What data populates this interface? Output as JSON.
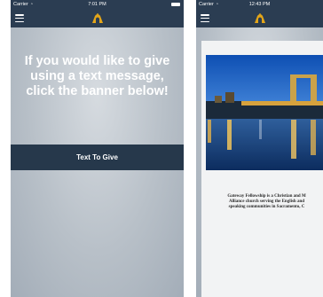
{
  "screens": [
    {
      "status": {
        "carrier": "Carrier",
        "time": "7:01 PM"
      },
      "message": "If you would like to give using a text message, click the banner below!",
      "banner_label": "Text To Give"
    },
    {
      "status": {
        "carrier": "Carrier",
        "time": "12:43 PM"
      },
      "about_text": "Gateway Fellowship is a Christian and M\nAlliance church serving the English and\nspeaking communities in Sacramento, C"
    }
  ],
  "icons": {
    "menu": "hamburger-menu-icon",
    "logo": "church-logo-icon",
    "wifi": "wifi-icon",
    "battery": "battery-icon"
  },
  "colors": {
    "nav_bar": "#2b3d52",
    "banner": "#26384b",
    "logo_gold": "#e2a519",
    "background": "#b8c0c8"
  }
}
